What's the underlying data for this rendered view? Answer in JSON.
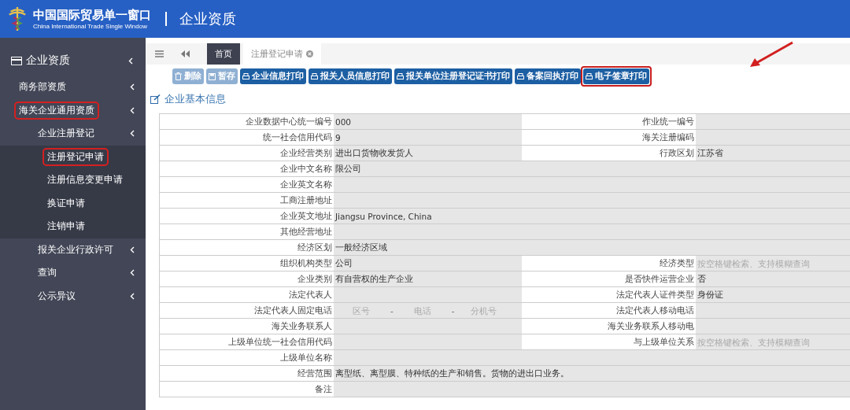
{
  "header": {
    "logo_title": "中国国际贸易单一窗口",
    "logo_subtitle": "China International Trade Single Window",
    "page_title": "企业资质"
  },
  "sidebar": {
    "title": "企业资质",
    "items": [
      {
        "label": "商务部资质",
        "highlighted": false
      },
      {
        "label": "海关企业通用资质",
        "highlighted": true,
        "children": [
          {
            "label": "企业注册登记",
            "highlighted": false,
            "children": [
              {
                "label": "注册登记申请",
                "highlighted": true
              },
              {
                "label": "注册信息变更申请",
                "highlighted": false
              },
              {
                "label": "换证申请",
                "highlighted": false
              },
              {
                "label": "注销申请",
                "highlighted": false
              }
            ]
          },
          {
            "label": "报关企业行政许可",
            "highlighted": false
          },
          {
            "label": "查询",
            "highlighted": false
          },
          {
            "label": "公示异议",
            "highlighted": false
          }
        ]
      }
    ]
  },
  "tabs": [
    {
      "label": "首页",
      "selected": true,
      "closable": false
    },
    {
      "label": "注册登记申请",
      "selected": false,
      "closable": true
    }
  ],
  "toolbar": [
    {
      "label": "删除",
      "kind": "delete",
      "disabled": true,
      "highlighted": false
    },
    {
      "label": "暂存",
      "kind": "save",
      "disabled": true,
      "highlighted": false
    },
    {
      "label": "企业信息打印",
      "kind": "print",
      "disabled": false,
      "highlighted": false
    },
    {
      "label": "报关人员信息打印",
      "kind": "print",
      "disabled": false,
      "highlighted": false
    },
    {
      "label": "报关单位注册登记证书打印",
      "kind": "print",
      "disabled": false,
      "highlighted": false
    },
    {
      "label": "备案回执打印",
      "kind": "print",
      "disabled": false,
      "highlighted": false
    },
    {
      "label": "电子签章打印",
      "kind": "print",
      "disabled": false,
      "highlighted": true
    }
  ],
  "section_title": "企业基本信息",
  "form_rows": [
    {
      "kind": "pair",
      "fields": [
        {
          "label": "企业数据中心统一编号",
          "value": "000"
        },
        {
          "label": "作业统一编号"
        }
      ]
    },
    {
      "kind": "pair",
      "fields": [
        {
          "label": "统一社会信用代码",
          "value": "9"
        },
        {
          "label": "海关注册编码"
        }
      ]
    },
    {
      "kind": "pair",
      "fields": [
        {
          "label": "企业经营类别",
          "value": "进出口货物收发货人"
        },
        {
          "label": "行政区划",
          "value": "江苏省"
        }
      ]
    },
    {
      "kind": "full",
      "fields": [
        {
          "label": "企业中文名称",
          "value": "限公司"
        }
      ]
    },
    {
      "kind": "full",
      "fields": [
        {
          "label": "企业英文名称"
        }
      ]
    },
    {
      "kind": "full",
      "fields": [
        {
          "label": "工商注册地址"
        }
      ]
    },
    {
      "kind": "full",
      "fields": [
        {
          "label": "企业英文地址",
          "value": "Jiangsu Province, China"
        }
      ]
    },
    {
      "kind": "full",
      "fields": [
        {
          "label": "其他经营地址"
        }
      ]
    },
    {
      "kind": "full",
      "fields": [
        {
          "label": "经济区划",
          "value": "一般经济区域"
        }
      ]
    },
    {
      "kind": "pair",
      "fields": [
        {
          "label": "组织机构类型",
          "value": "公司"
        },
        {
          "label": "经济类型",
          "placeholder": "按空格键检索、支持模糊查询"
        }
      ]
    },
    {
      "kind": "pair",
      "fields": [
        {
          "label": "企业类别",
          "value": "有自营权的生产企业"
        },
        {
          "label": "是否快件运营企业",
          "value": "否"
        }
      ]
    },
    {
      "kind": "pair",
      "fields": [
        {
          "label": "法定代表人"
        },
        {
          "label": "法定代表人证件类型",
          "value": "身份证"
        }
      ]
    },
    {
      "kind": "pair",
      "fields": [
        {
          "label": "法定代表人固定电话",
          "phone": [
            {
              "placeholder": "区号"
            },
            {
              "placeholder": "电话"
            },
            {
              "placeholder": "分机号"
            }
          ],
          "separator": "-"
        },
        {
          "label": "法定代表人移动电话"
        }
      ]
    },
    {
      "kind": "pair",
      "fields": [
        {
          "label": "海关业务联系人"
        },
        {
          "label": "海关业务联系人移动电"
        }
      ]
    },
    {
      "kind": "pair",
      "fields": [
        {
          "label": "上级单位统一社会信用代码"
        },
        {
          "label": "与上级单位关系",
          "placeholder": "按空格键检索、支持模糊查询"
        }
      ]
    },
    {
      "kind": "full",
      "fields": [
        {
          "label": "上级单位名称"
        }
      ]
    },
    {
      "kind": "full",
      "fields": [
        {
          "label": "经营范围",
          "value": "离型纸、离型膜、特种纸的生产和销售。货物的进出口业务。"
        }
      ]
    },
    {
      "kind": "full",
      "fields": [
        {
          "label": "备注"
        }
      ]
    }
  ]
}
